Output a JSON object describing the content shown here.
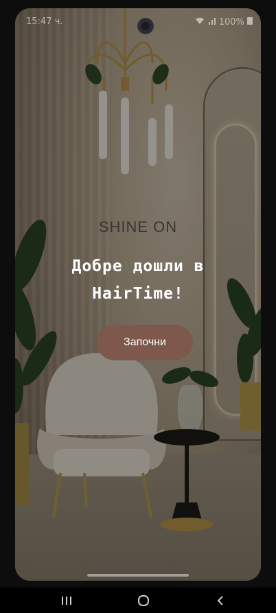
{
  "status_bar": {
    "time": "15:47 ч.",
    "battery": "100%",
    "icons": [
      "wifi-icon",
      "signal-icon",
      "battery-icon"
    ]
  },
  "brand": "SHINE ON",
  "welcome": {
    "line1": "Добре дошли в",
    "line2": "HairTime!"
  },
  "start_button": "Започни",
  "nav": [
    "recents-icon",
    "home-icon",
    "back-icon"
  ],
  "colors": {
    "button": "#7e574d",
    "overlay": "rgba(0,0,0,0.38)"
  }
}
